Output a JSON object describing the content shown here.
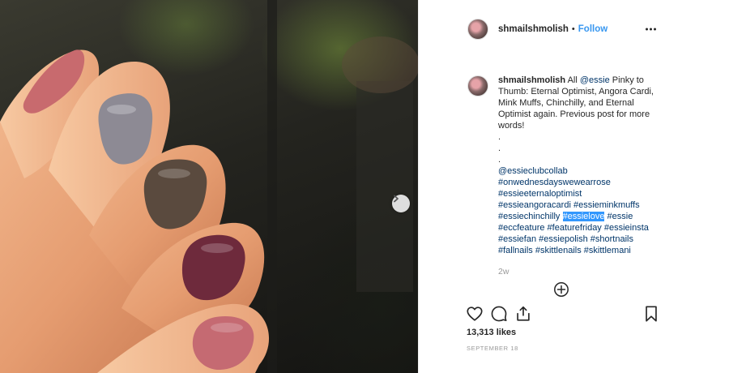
{
  "post": {
    "username": "shmailshmolish",
    "separator": "•",
    "follow_label": "Follow",
    "more_icon": "more-horizontal-icon"
  },
  "caption": {
    "username": "shmailshmolish",
    "text_lead": "All ",
    "mention_essie": "@essie",
    "text_body": " Pinky to Thumb: Eternal Optimist, Angora Cardi, Mink Muffs, Chinchilly, and Eternal Optimist again. Previous post for more words!",
    "dots": [
      ".",
      ".",
      "."
    ],
    "mention_collab": "@essieclubcollab",
    "tags": {
      "t1": "#onwednesdayswewearrose",
      "t2": "#essieeternaloptimist",
      "t3": "#essieangoracardi",
      "t4": "#essieminkmuffs",
      "t5": "#essiechinchilly",
      "t6": "#essielove",
      "t7": "#essie",
      "t8": "#eccfeature",
      "t9": "#featurefriday",
      "t10": "#essieinsta",
      "t11": "#essiefan",
      "t12": "#essiepolish",
      "t13": "#shortnails",
      "t14": "#fallnails",
      "t15": "#skittlenails",
      "t16": "#skittlemani"
    },
    "time_ago": "2w"
  },
  "engagement": {
    "likes": "13,313 likes",
    "date": "SEPTEMBER 18"
  },
  "colors": {
    "link": "#003569",
    "follow": "#3897f0",
    "selection": "#3297fd",
    "nail_pinky": "#c86a6e",
    "nail_ring": "#8d8a94",
    "nail_middle": "#5a4a3e",
    "nail_index": "#6e2a3c",
    "nail_thumb": "#c56a72"
  }
}
